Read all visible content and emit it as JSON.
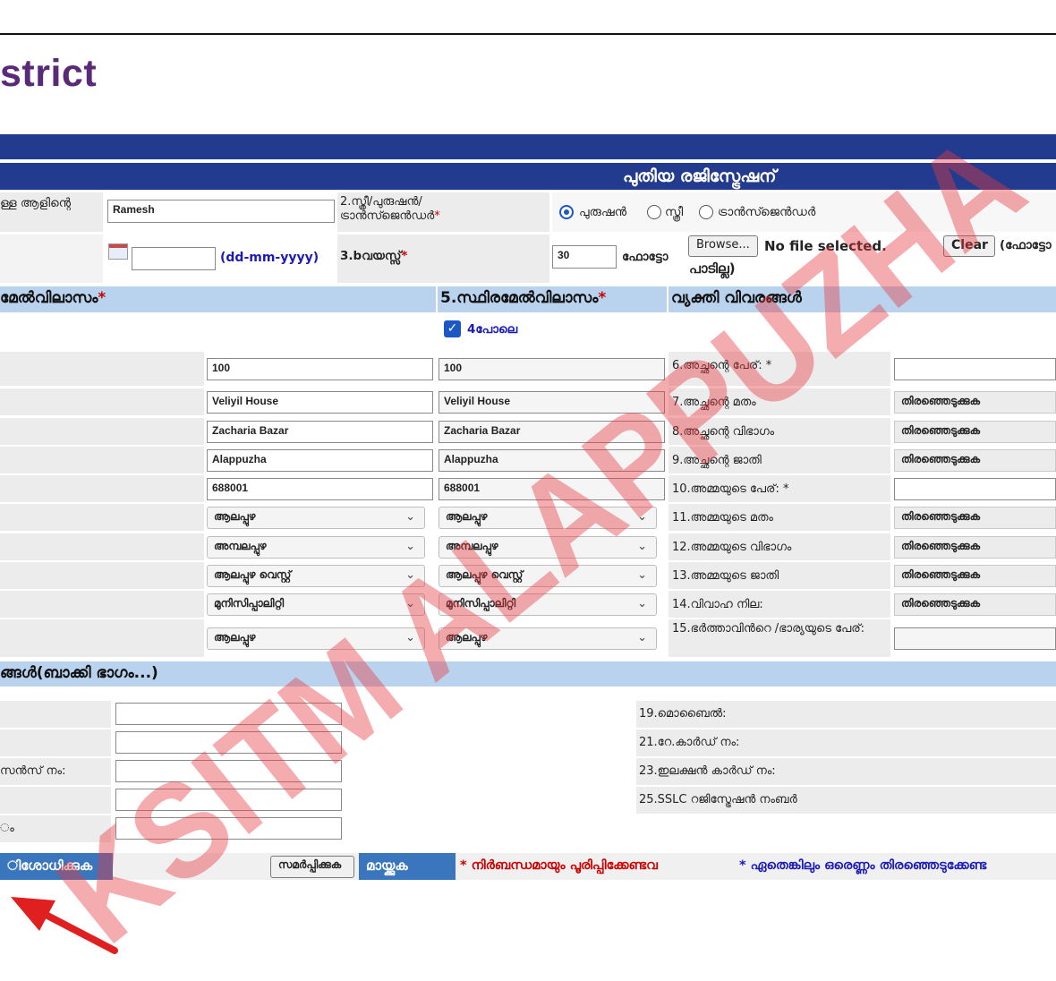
{
  "header": {
    "district_text": "strict"
  },
  "form": {
    "title": "പുതിയ രജിസ്ട്രേഷന്",
    "row1": {
      "name_label": "ള്ള ആളിന്റെ",
      "name_value": "Ramesh",
      "gender_label": "2.സ്ത്രീ/പുരുഷൻ/ ട്രാൻസ്ജെൻഡർ",
      "gender_options": [
        "പുരുഷൻ",
        "സ്ത്രീ",
        "ട്രാൻസ്ജെൻഡർ"
      ]
    },
    "row2": {
      "date_hint": "(dd-mm-yyyy)",
      "age_label": "3.bവയസ്സ്",
      "age_value": "30",
      "photo_label": "ഫോട്ടോ",
      "browse_label": "Browse...",
      "no_file_text": "No file selected.",
      "clear_label": "Clear",
      "photo_note": "(ഫോട്ടോ",
      "not_uploaded_text": "പാടില്ല)"
    },
    "section_headers": {
      "present_address": "മേൽവിലാസം",
      "permanent_address": "5.സ്ഥിരമേൽവിലാസം",
      "personal_details": "വ്യക്തി വിവരങ്ങൾ",
      "remaining": "ങ്ങൾ(ബാക്കി ഭാഗം...)"
    },
    "same_as_4_label": "4പോലെ",
    "address": {
      "present": [
        "100",
        "Veliyil House",
        "Zacharia Bazar",
        "Alappuzha",
        "688001"
      ],
      "permanent": [
        "100",
        "Veliyil House",
        "Zacharia Bazar",
        "Alappuzha",
        "688001"
      ],
      "present_selects": [
        "ആലപ്പുഴ",
        "അമ്പലപ്പുഴ",
        "ആലപ്പുഴ വെസ്റ്റ്",
        "മുനിസിപ്പാലിറ്റി",
        "ആലപ്പുഴ"
      ],
      "permanent_selects": [
        "ആലപ്പുഴ",
        "അമ്പലപ്പുഴ",
        "ആലപ്പുഴ വെസ്റ്റ്",
        "മുനിസിപ്പാലിറ്റി",
        "ആലപ്പുഴ"
      ]
    },
    "personal": {
      "labels": [
        "6.അച്ഛന്റെ പേര്: *",
        "7.അച്ഛന്റെ മതം",
        "8.അച്ഛന്റെ വിഭാഗം",
        "9.അച്ഛന്റെ ജാതി",
        "10.അമ്മയുടെ പേര്: *",
        "11.അമ്മയുടെ മതം",
        "12.അമ്മയുടെ വിഭാഗം",
        "13.അമ്മയുടെ ജാതി",
        "14.വിവാഹ നില:",
        "15.ഭർത്താവിൻറെ /ഭാര്യയുടെ പേര്:"
      ],
      "select_placeholder": "തിരഞ്ഞെടുക്കുക"
    },
    "remaining": {
      "left_labels": [
        "",
        "",
        "സൻസ് നം:",
        "",
        "ം"
      ],
      "right_labels": [
        "19.മൊബൈൽ:",
        "21.റേ.കാർഡ് നം:",
        "23.ഇലക്ഷൻ കാർഡ് നം:",
        "25.SSLC റജിസ്ട്രേഷൻ നംബർ"
      ]
    },
    "footer": {
      "verify_label": "ിശോധിക്കുക",
      "submit_label": "സമർപ്പിക്കുക",
      "clear_label": "മായ്ക്കുക",
      "note1": "* നിർബന്ധമായും പൂരിപ്പിക്കേണ്ടവ",
      "note2": "* ഏതെങ്കിലും ഒരെണ്ണം തിരഞ്ഞെടുക്കേണ്ട"
    }
  },
  "watermark": {
    "text": "KSITM ALAPPUZHA",
    "color": "#e8393f"
  },
  "colors": {
    "nav": "#233b8e",
    "section": "#b9d3ef",
    "link_blue": "#1b1bb8",
    "required": "#cc0000",
    "district": "#5a2a78"
  }
}
